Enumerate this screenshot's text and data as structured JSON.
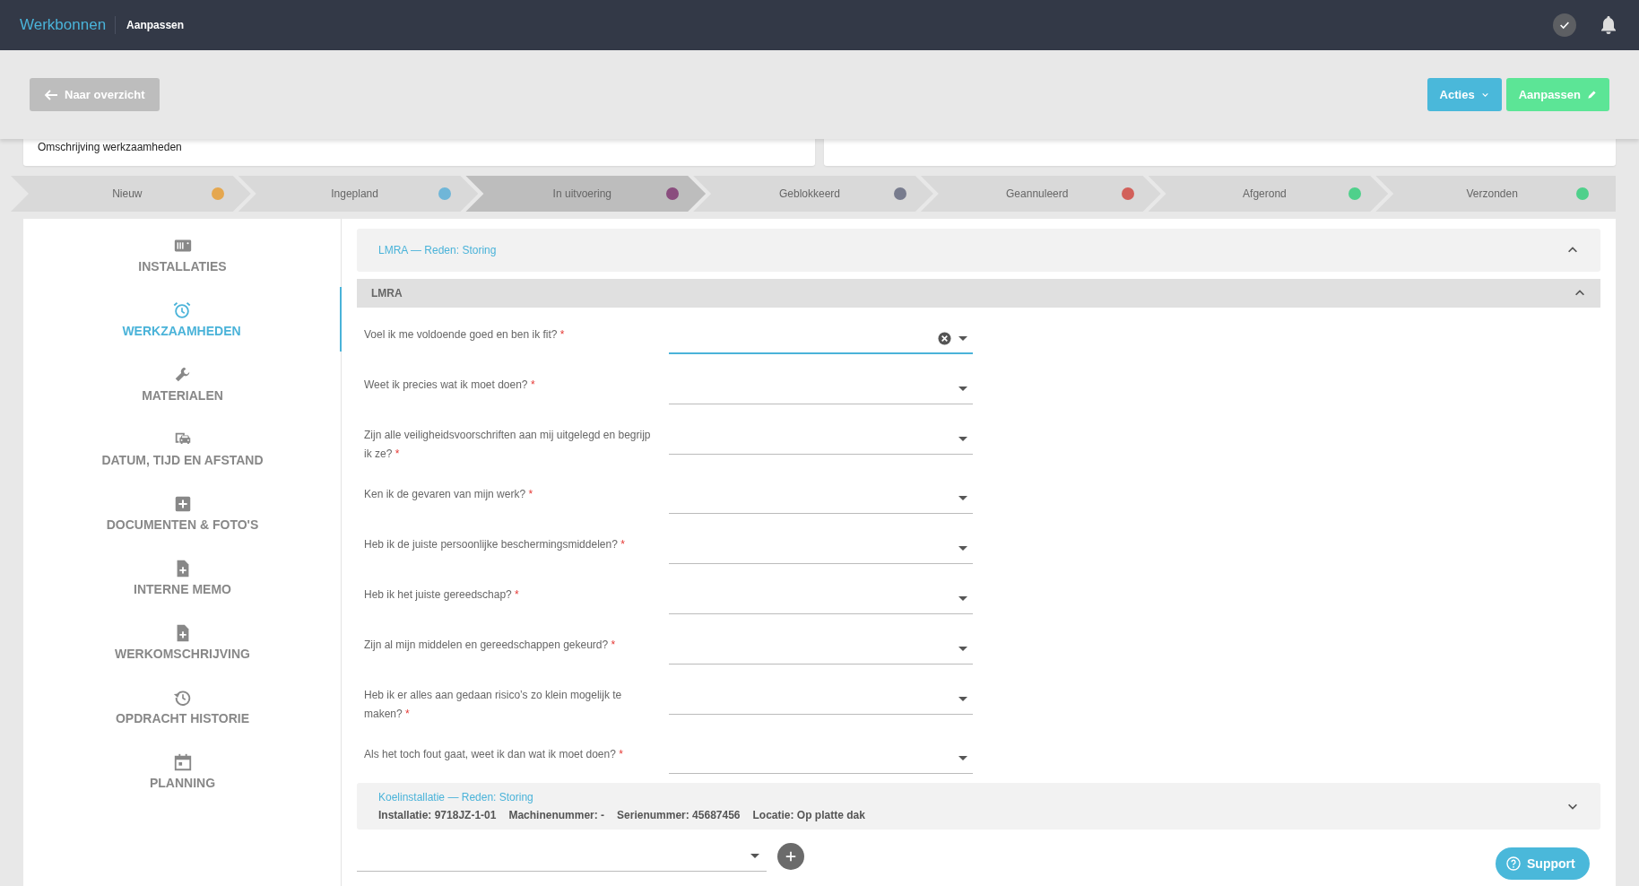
{
  "header": {
    "app_title": "Werkbonnen",
    "page_title": "Aanpassen"
  },
  "toolbar": {
    "back_button": "Naar overzicht",
    "actions_button": "Acties",
    "edit_button": "Aanpassen"
  },
  "description_card": {
    "label": "Omschrijving werkzaamheden"
  },
  "statuses": [
    {
      "label": "Nieuw",
      "color": "#e5a74f",
      "selected": false
    },
    {
      "label": "Ingepland",
      "color": "#6fb6d8",
      "selected": false
    },
    {
      "label": "In uitvoering",
      "color": "#8a4d7e",
      "selected": true
    },
    {
      "label": "Geblokkeerd",
      "color": "#787c8e",
      "selected": false
    },
    {
      "label": "Geannuleerd",
      "color": "#d2605a",
      "selected": false
    },
    {
      "label": "Afgerond",
      "color": "#4fd08b",
      "selected": false
    },
    {
      "label": "Verzonden",
      "color": "#4fd08b",
      "selected": false
    }
  ],
  "sidebar": {
    "items": [
      {
        "label": "INSTALLATIES",
        "selected": false
      },
      {
        "label": "WERKZAAMHEDEN",
        "selected": true
      },
      {
        "label": "MATERIALEN",
        "selected": false
      },
      {
        "label": "DATUM, TIJD EN AFSTAND",
        "selected": false
      },
      {
        "label": "DOCUMENTEN & FOTO'S",
        "selected": false
      },
      {
        "label": "INTERNE MEMO",
        "selected": false
      },
      {
        "label": "WERKOMSCHRIJVING",
        "selected": false
      },
      {
        "label": "OPDRACHT HISTORIE",
        "selected": false
      },
      {
        "label": "PLANNING",
        "selected": false
      }
    ]
  },
  "lmra_panel": {
    "title": "LMRA — Reden: Storing",
    "expanded": true,
    "section": {
      "title": "LMRA",
      "expanded": true
    },
    "questions": [
      {
        "label": "Voel ik me voldoende goed en ben ik fit?",
        "required_mark": "*",
        "focused": true
      },
      {
        "label": "Weet ik precies wat ik moet doen?",
        "required_mark": "*",
        "focused": false
      },
      {
        "label": "Zijn alle veiligheidsvoorschriften aan mij uitgelegd en begrijp ik ze?",
        "required_mark": "*",
        "focused": false
      },
      {
        "label": "Ken ik de gevaren van mijn werk?",
        "required_mark": "*",
        "focused": false
      },
      {
        "label": "Heb ik de juiste persoonlijke beschermingsmiddelen?",
        "required_mark": "*",
        "focused": false
      },
      {
        "label": "Heb ik het juiste gereedschap?",
        "required_mark": "*",
        "focused": false
      },
      {
        "label": "Zijn al mijn middelen en gereedschappen gekeurd?",
        "required_mark": "*",
        "focused": false
      },
      {
        "label": "Heb ik er alles aan gedaan risico’s zo klein mogelijk te maken?",
        "required_mark": "*",
        "focused": false
      },
      {
        "label": "Als het toch fout gaat, weet ik dan wat ik moet doen?",
        "required_mark": "*",
        "focused": false
      }
    ]
  },
  "installation": {
    "title": "Koelinstallatie — Reden: Storing",
    "expanded": false,
    "details": [
      "Installatie: 9718JZ-1-01",
      "Machinenummer: -",
      "Serienummer: 45687456",
      "Locatie: Op platte dak"
    ]
  },
  "support_button": "Support"
}
